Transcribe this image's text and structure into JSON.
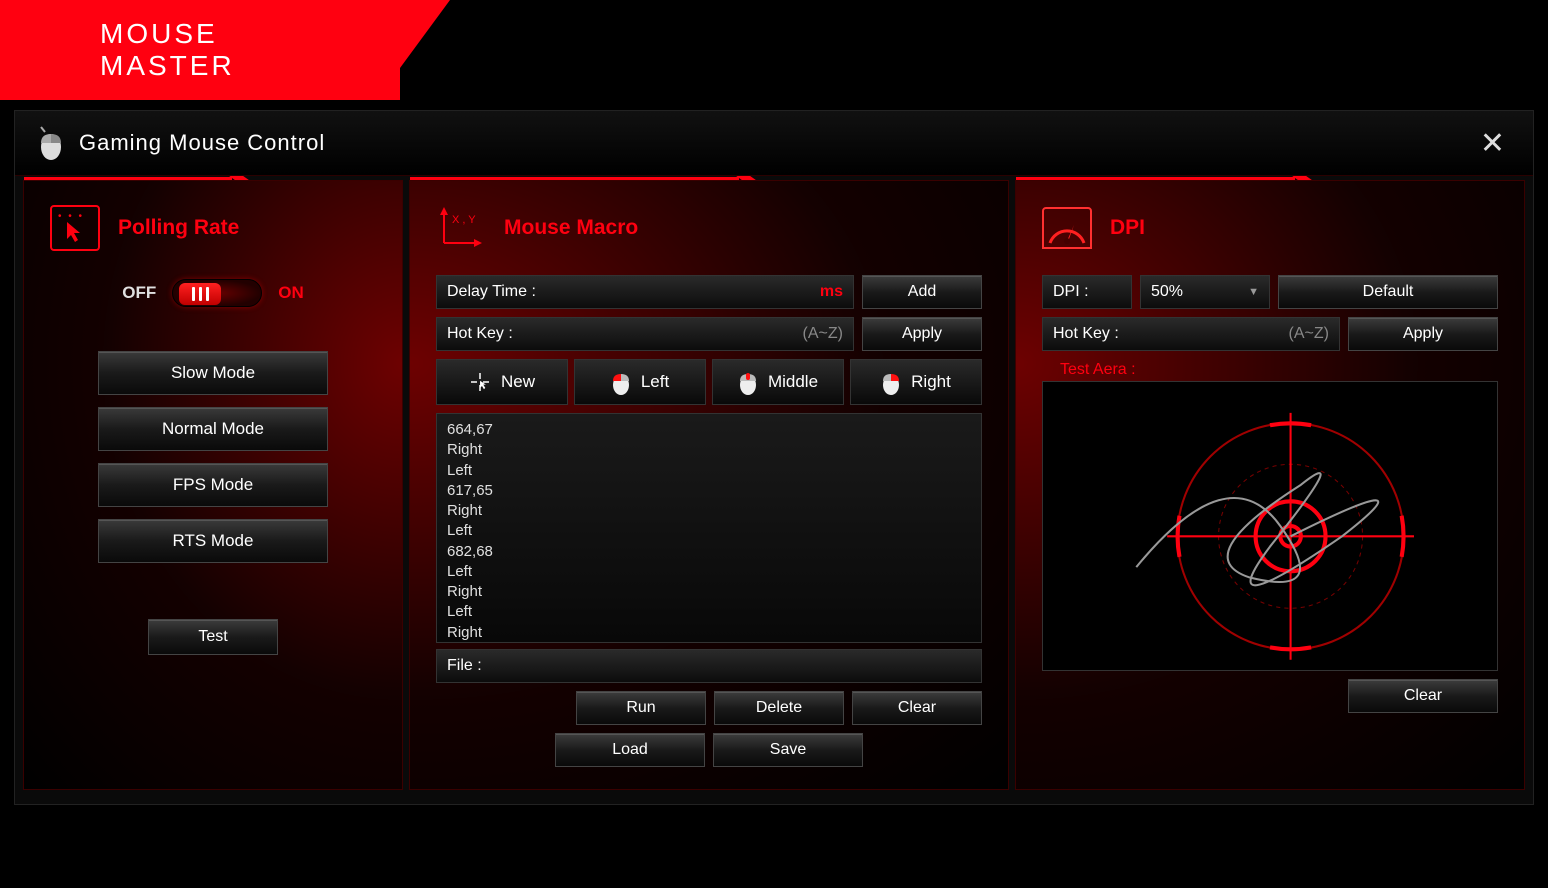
{
  "header": {
    "title": "MOUSE MASTER"
  },
  "window": {
    "title": "Gaming Mouse Control"
  },
  "polling": {
    "title": "Polling Rate",
    "off": "OFF",
    "on": "ON",
    "modes": [
      "Slow Mode",
      "Normal Mode",
      "FPS Mode",
      "RTS Mode"
    ],
    "test": "Test"
  },
  "macro": {
    "title": "Mouse Macro",
    "delay_label": "Delay Time :",
    "delay_unit": "ms",
    "add": "Add",
    "hotkey_label": "Hot Key :",
    "hotkey_placeholder": "(A~Z)",
    "apply": "Apply",
    "click_buttons": [
      "New",
      "Left",
      "Middle",
      "Right"
    ],
    "events": [
      "664,67",
      "Right",
      "Left",
      "617,65",
      "Right",
      "Left",
      "682,68",
      "Left",
      "Right",
      "Left",
      "Right"
    ],
    "file_label": "File :",
    "run": "Run",
    "delete": "Delete",
    "clear": "Clear",
    "load": "Load",
    "save": "Save"
  },
  "dpi": {
    "title": "DPI",
    "dpi_label": "DPI :",
    "dpi_value": "50%",
    "default": "Default",
    "hotkey_label": "Hot Key :",
    "hotkey_placeholder": "(A~Z)",
    "apply": "Apply",
    "test_area_label": "Test Aera :",
    "clear": "Clear"
  }
}
